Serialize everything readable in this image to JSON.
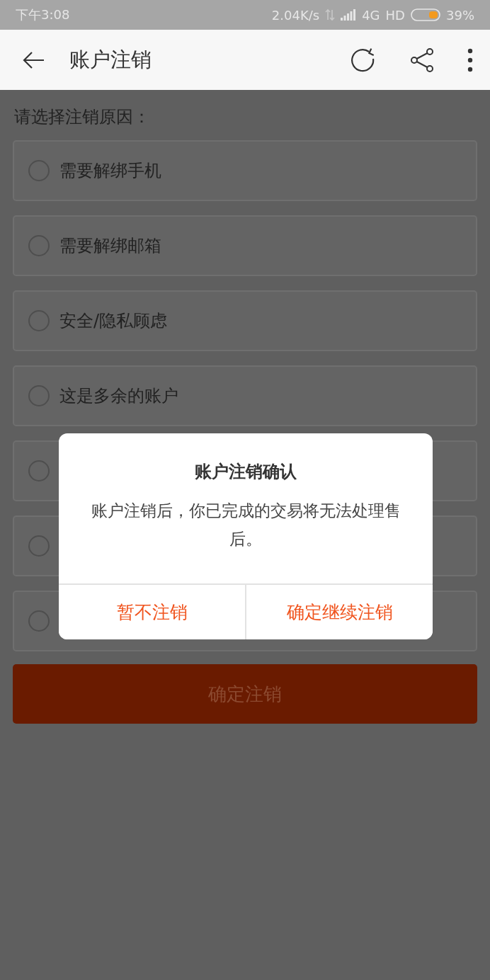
{
  "status_bar": {
    "time": "下午3:08",
    "speed": "2.04K/s",
    "network": "4G",
    "hd": "HD",
    "battery": "39%"
  },
  "app_bar": {
    "title": "账户注销"
  },
  "prompt": "请选择注销原因：",
  "reasons": [
    {
      "label": "需要解绑手机",
      "selected": false
    },
    {
      "label": "需要解绑邮箱",
      "selected": false
    },
    {
      "label": "安全/隐私顾虑",
      "selected": false
    },
    {
      "label": "这是多余的账户",
      "selected": false
    },
    {
      "selected": false
    },
    {
      "selected": false
    },
    {
      "selected": false
    }
  ],
  "submit_button": {
    "label": "确定注销",
    "disabled": true
  },
  "dialog": {
    "title": "账户注销确认",
    "message": "账户注销后，你已完成的交易将无法处理售后。",
    "buttons": [
      "暂不注销",
      "确定继续注销"
    ]
  }
}
